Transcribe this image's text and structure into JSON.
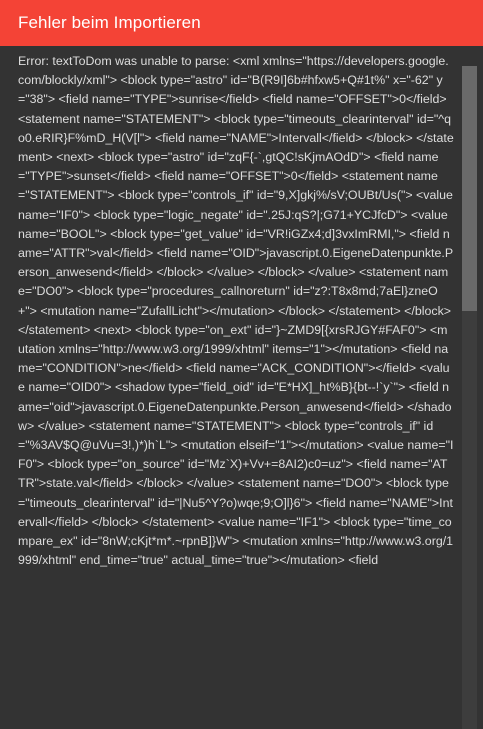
{
  "dialog": {
    "title": "Fehler beim Importieren",
    "message": "Error: textToDom was unable to parse: <xml xmlns=\"https://developers.google.com/blockly/xml\"> <block type=\"astro\" id=\"B(R9I]6b#hfxw5+Q#1t%\" x=\"-62\" y=\"38\"> <field name=\"TYPE\">sunrise</field> <field name=\"OFFSET\">0</field> <statement name=\"STATEMENT\"> <block type=\"timeouts_clearinterval\" id=\"^qo0.eRIR}F%mD_H(V[l\"> <field name=\"NAME\">Intervall</field> </block> </statement> <next> <block type=\"astro\" id=\"zqF{-`,gtQC!sKjmAOdD\"> <field name=\"TYPE\">sunset</field> <field name=\"OFFSET\">0</field> <statement name=\"STATEMENT\"> <block type=\"controls_if\" id=\"9,X]gkj%/sV;OUBt/Us(\"> <value name=\"IF0\"> <block type=\"logic_negate\" id=\".25J:qS?|;G71+YCJfcD\"> <value name=\"BOOL\"> <block type=\"get_value\" id=\"VR!iGZx4;d]3vxImRMI,\"> <field name=\"ATTR\">val</field> <field name=\"OID\">javascript.0.EigeneDatenpunkte.Person_anwesend</field> </block> </value> </block> </value> <statement name=\"DO0\"> <block type=\"procedures_callnoreturn\" id=\"z?:T8x8md;7aEl}zneO+\"> <mutation name=\"ZufallLicht\"></mutation> </block> </statement> </block> </statement> <next> <block type=\"on_ext\" id=\"}~ZMD9[{xrsRJGY#FAF0\"> <mutation xmlns=\"http://www.w3.org/1999/xhtml\" items=\"1\"></mutation> <field name=\"CONDITION\">ne</field> <field name=\"ACK_CONDITION\"></field> <value name=\"OID0\"> <shadow type=\"field_oid\" id=\"E*HX]_ht%B}{bt--!`y`\"> <field name=\"oid\">javascript.0.EigeneDatenpunkte.Person_anwesend</field> </shadow> </value> <statement name=\"STATEMENT\"> <block type=\"controls_if\" id=\"%3AV$Q@uVu=3!,)*)h`L\"> <mutation elseif=\"1\"></mutation> <value name=\"IF0\"> <block type=\"on_source\" id=\"Mz`X)+Vv+=8AI2)c0=uz\"> <field name=\"ATTR\">state.val</field> </block> </value> <statement name=\"DO0\"> <block type=\"timeouts_clearinterval\" id=\"|Nu5^Y?o)wqe;9;O]l}6\"> <field name=\"NAME\">Intervall</field> </block> </statement> <value name=\"IF1\"> <block type=\"time_compare_ex\" id=\"8nW;cKjt*m*.~rpnB]}W\"> <mutation xmlns=\"http://www.w3.org/1999/xhtml\" end_time=\"true\" actual_time=\"true\"></mutation> <field"
  },
  "scrollbar": {
    "position": 0,
    "visible_fraction": 0.37
  },
  "colors": {
    "titlebar_bg": "#f44336",
    "title_text": "#ffffff",
    "body_bg": "#333333",
    "body_text": "#dddddd",
    "scroll_track": "#3d3d3d",
    "scroll_thumb": "#6a6a6a"
  }
}
